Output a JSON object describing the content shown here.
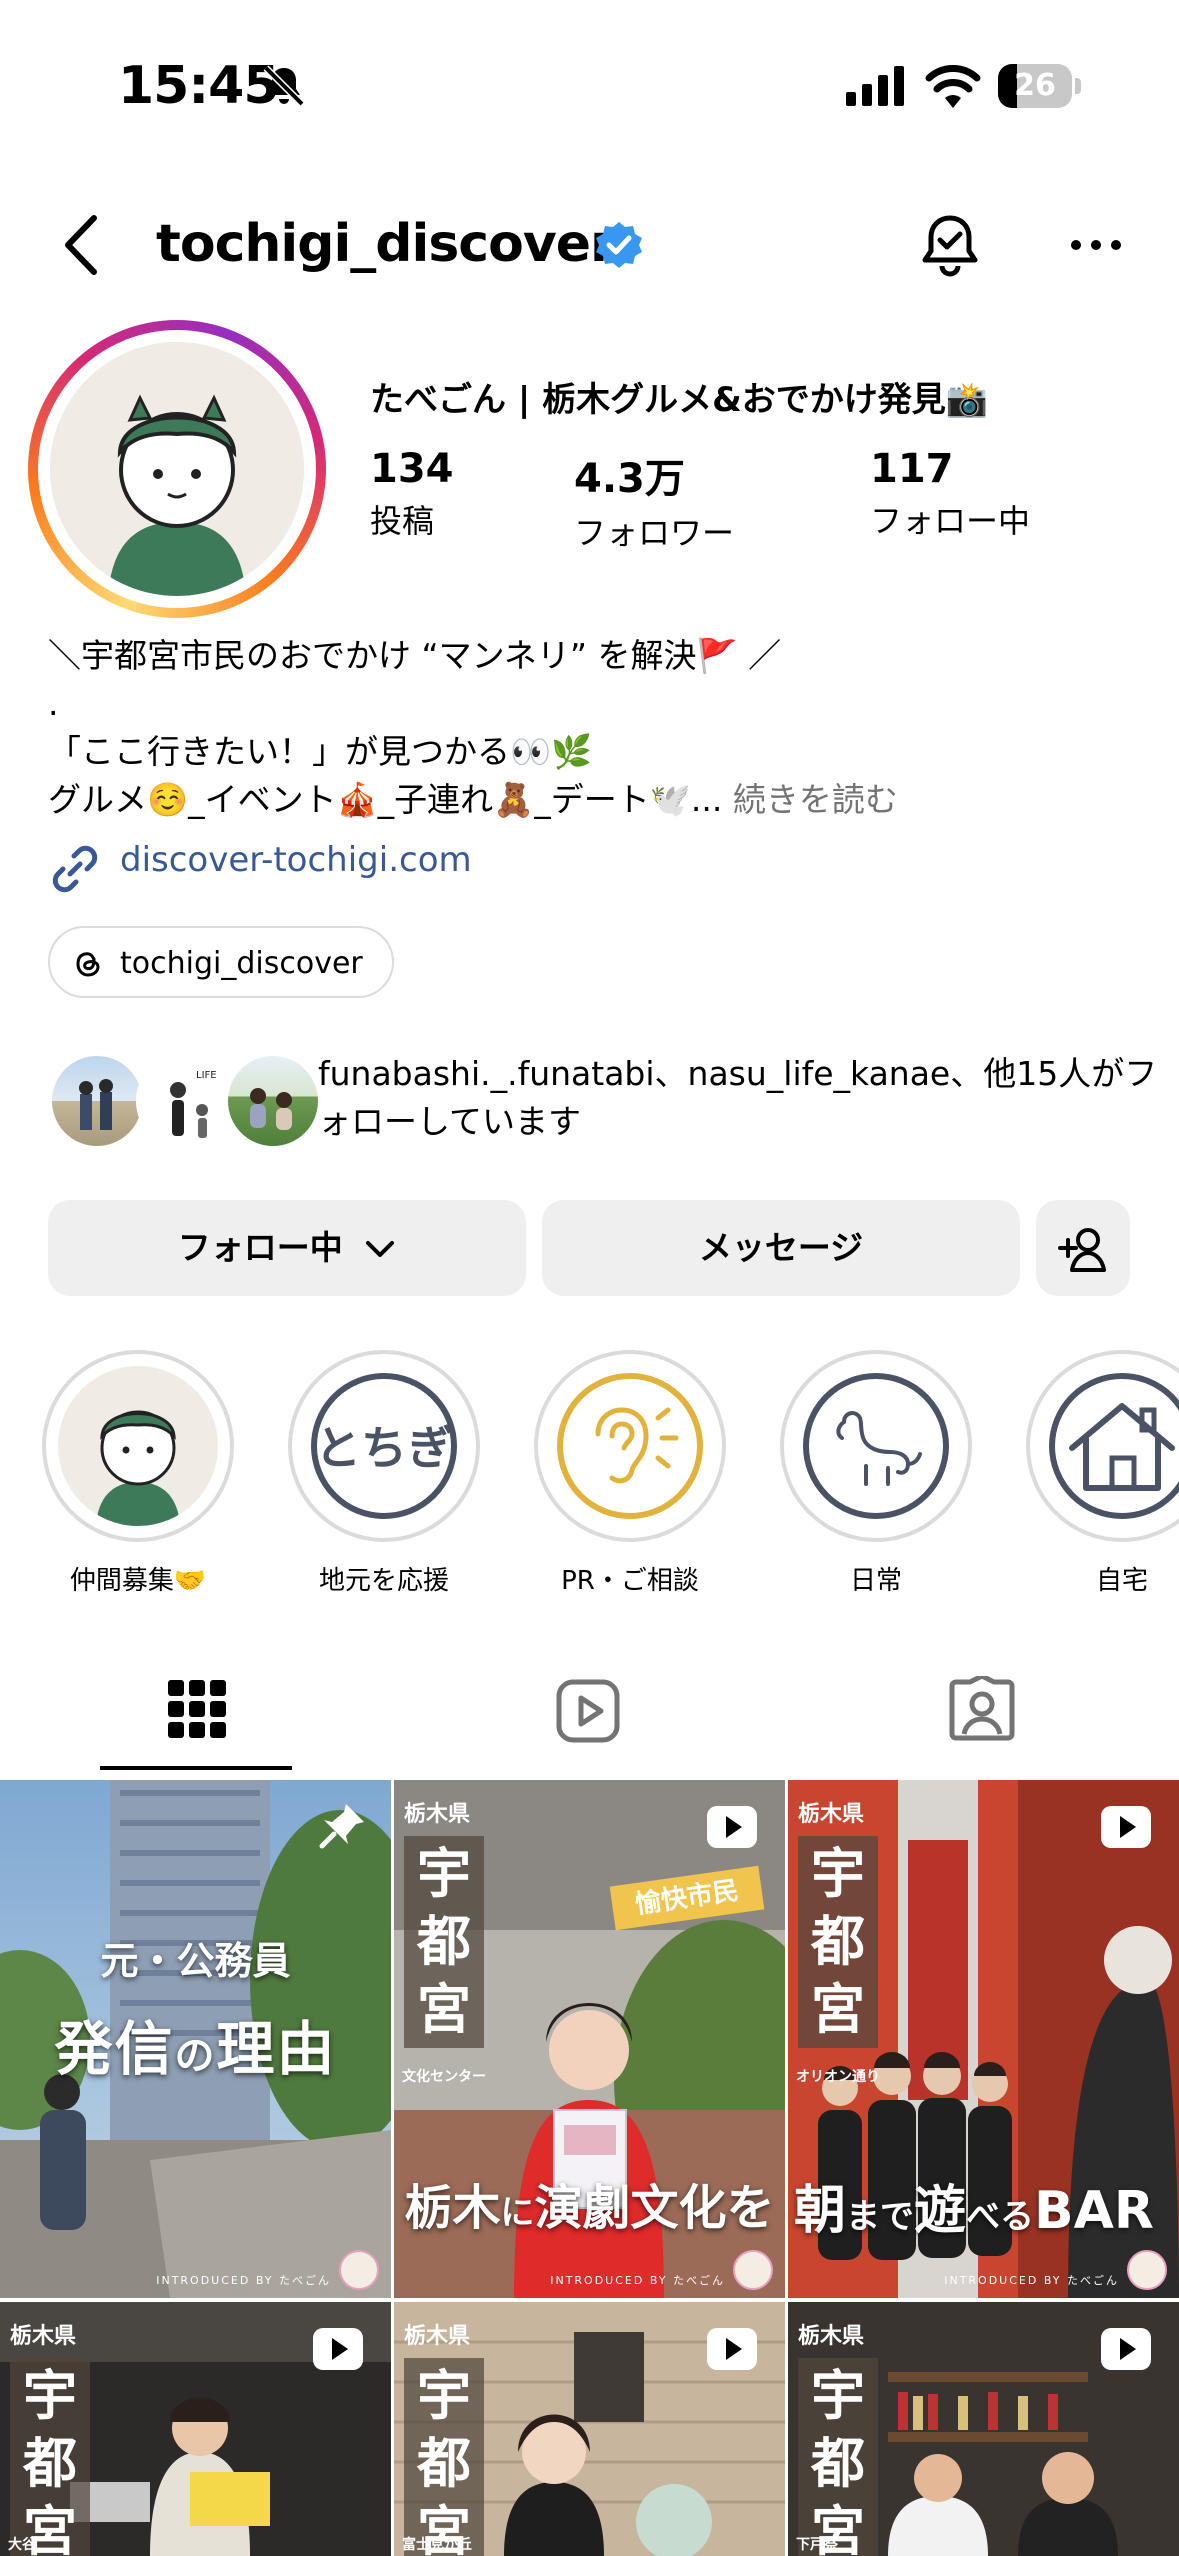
{
  "status": {
    "time": "15:45",
    "battery": "26",
    "battery_level": 0.26
  },
  "header": {
    "username": "tochigi_discover"
  },
  "profile": {
    "display_name": "たべごん | 栃木グルメ&おでかけ発見📸",
    "stats": [
      {
        "value": "134",
        "label": "投稿"
      },
      {
        "value": "4.3万",
        "label": "フォロワー"
      },
      {
        "value": "117",
        "label": "フォロー中"
      }
    ],
    "bio": {
      "line1": "＼宇都宮市民のおでかけ “マンネリ” を解決🚩 ／",
      "line2": ".",
      "line3": "「ここ行きたい！」が見つかる👀🌿",
      "line4": "グルメ☺️_イベント🎪_子連れ🧸_デート🕊️... ",
      "read_more": "続きを読む"
    },
    "link": "discover-tochigi.com",
    "threads": "tochigi_discover"
  },
  "mutual": {
    "text": "funabashi._.funatabi、nasu_life_kanae、他15人がフォローしています"
  },
  "actions": {
    "following": "フォロー中",
    "message": "メッセージ"
  },
  "highlights": [
    {
      "label": "仲間募集🤝"
    },
    {
      "label": "地元を応援",
      "title": "とちぎ"
    },
    {
      "label": "PR・ご相談"
    },
    {
      "label": "日常"
    },
    {
      "label": "自宅"
    }
  ],
  "posts": [
    {
      "line1": "元・公務員",
      "line2a": "発信",
      "line2b": "の",
      "line2c": "理由",
      "credit": "INTRODUCED BY たべごん"
    },
    {
      "pref": "栃木県",
      "city": "宇都宮",
      "sub": "文化センター",
      "tag": "愉快市民",
      "cap_a": "栃木",
      "cap_b": "に",
      "cap_c": "演劇文化を",
      "credit": "INTRODUCED BY たべごん"
    },
    {
      "pref": "栃木県",
      "city": "宇都宮",
      "sub": "オリオン通り",
      "cap_a": "朝",
      "cap_b": "まで",
      "cap_c": "遊",
      "cap_d": "べる",
      "cap_e": "BAR",
      "credit": "INTRODUCED BY たべごん"
    },
    {
      "pref": "栃木県",
      "city": "宇都宮",
      "sub": "大谷"
    },
    {
      "pref": "栃木県",
      "city": "宇都宮",
      "sub": "富士見が丘"
    },
    {
      "pref": "栃木県",
      "city": "宇都宮",
      "sub": "下戸祭"
    }
  ]
}
